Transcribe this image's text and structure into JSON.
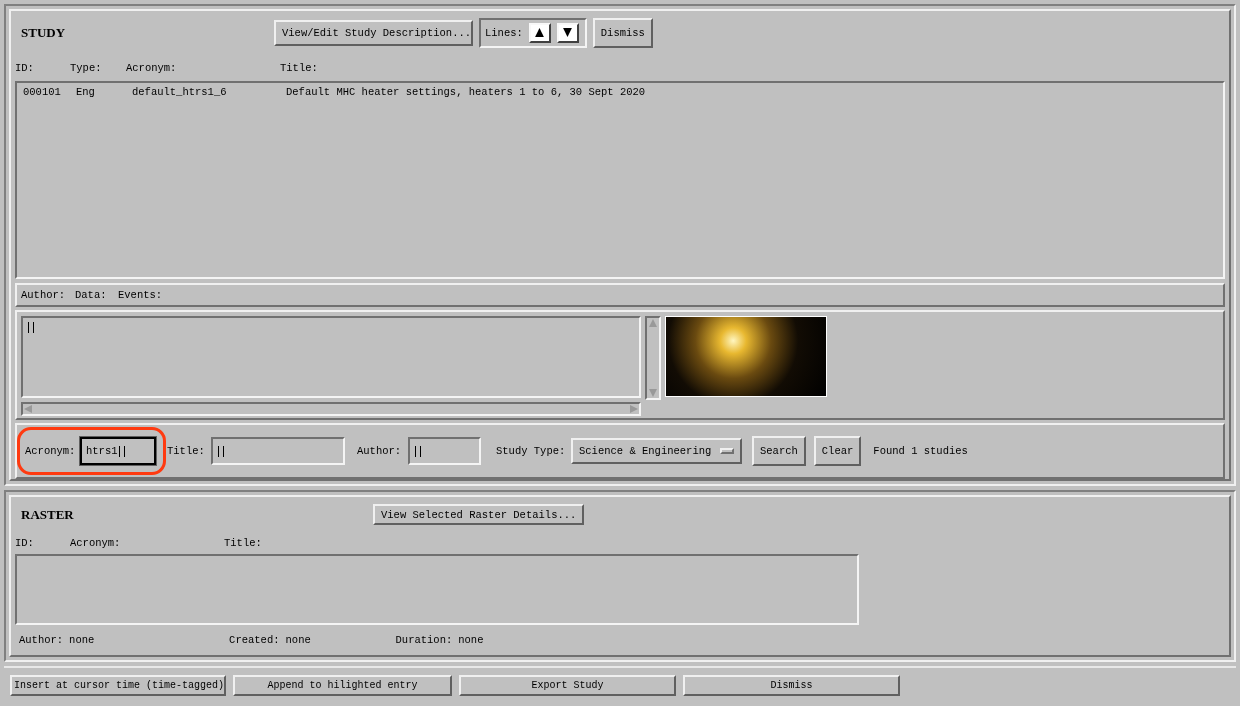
{
  "study": {
    "heading": "STUDY",
    "description_button": "View/Edit Study Description...",
    "lines_label": "Lines:",
    "dismiss_button": "Dismiss",
    "columns": [
      "ID:",
      "Type:",
      "Acronym:",
      "Title:"
    ],
    "rows": [
      {
        "id": "000101",
        "type": "Eng",
        "acronym": "default_htrs1_6",
        "title": "Default MHC heater settings, heaters 1 to 6, 30 Sept 2020",
        "selected": false
      }
    ],
    "detail_labels": [
      "Author:",
      "Data:",
      "Events:"
    ],
    "search": {
      "fields": [
        {
          "label": "Acronym:",
          "value": "htrs1",
          "focused": true,
          "highlighted": true
        },
        {
          "label": "Title:",
          "focused": false,
          "highlighted": false
        },
        {
          "label": "Author:",
          "focused": false,
          "highlighted": false
        }
      ],
      "study_type": {
        "label": "Study Type:",
        "value": "Science & Engineering"
      },
      "search_button": "Search",
      "clear_button": "Clear",
      "status": "Found 1 studies"
    }
  },
  "raster": {
    "heading": "RASTER",
    "details_button": "View Selected Raster Details...",
    "columns": [
      "ID:",
      "Acronym:",
      "Title:"
    ],
    "info": [
      {
        "label": "Author:",
        "value": "none"
      },
      {
        "label": "Created:",
        "value": "none"
      },
      {
        "label": "Duration:",
        "value": "none"
      }
    ]
  },
  "bottom_buttons": [
    "Insert at cursor time (time-tagged)",
    "Append to hilighted entry",
    "Export Study",
    "Dismiss"
  ]
}
